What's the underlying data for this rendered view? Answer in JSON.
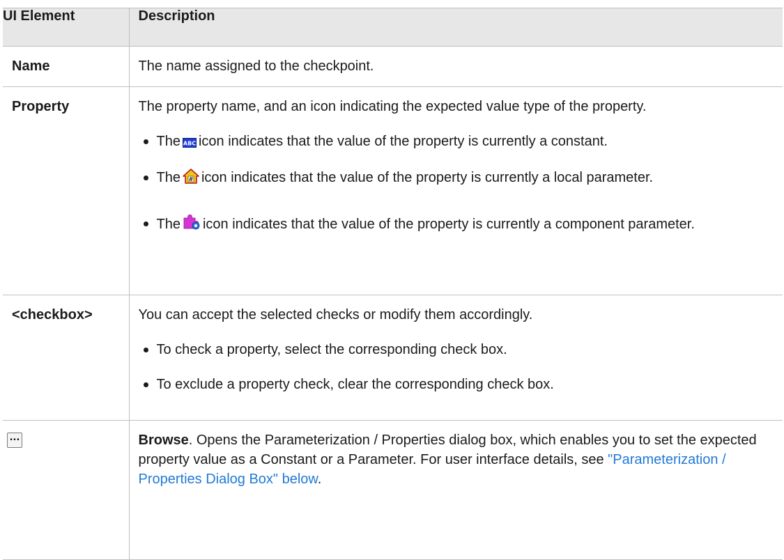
{
  "table": {
    "headers": {
      "element": "UI Element",
      "description": "Description"
    },
    "rows": {
      "name": {
        "element": "Name",
        "description": "The name assigned to the checkpoint."
      },
      "property": {
        "element": "Property",
        "description": "The property name, and an icon indicating the expected value type of the property.",
        "bullets": [
          {
            "pre": "The",
            "icon": "abc-constant-icon",
            "post": "icon indicates that the value of the property is currently a constant."
          },
          {
            "pre": "The",
            "icon": "local-parameter-house-icon",
            "post": "icon indicates that the value of the property is currently a local parameter."
          },
          {
            "pre": "The",
            "icon": "component-parameter-puzzle-icon",
            "post": "icon indicates that the value of the property is currently a component parameter."
          }
        ]
      },
      "checkbox": {
        "element": "<checkbox>",
        "description": "You can accept the selected checks or modify them accordingly.",
        "bullets": [
          "To check a property, select the corresponding check box.",
          "To exclude a property check, clear the corresponding check box."
        ]
      },
      "browse": {
        "element_icon": "browse-ellipsis-icon",
        "element_glyph": "...",
        "bold": "Browse",
        "description": ". Opens the Parameterization / Properties dialog box, which enables you to set the expected property value as a Constant or a Parameter. For user interface details, see ",
        "link": "\"Parameterization / Properties Dialog Box\" below",
        "end": "."
      }
    }
  },
  "colors": {
    "header_bg": "#e7e7e7",
    "border": "#bfbfbf",
    "link": "#1f7ad6",
    "abc_icon_bg": "#1d3bd8",
    "house_icon_fill": "#f2c51a",
    "puzzle_icon_fill": "#d633d6"
  }
}
